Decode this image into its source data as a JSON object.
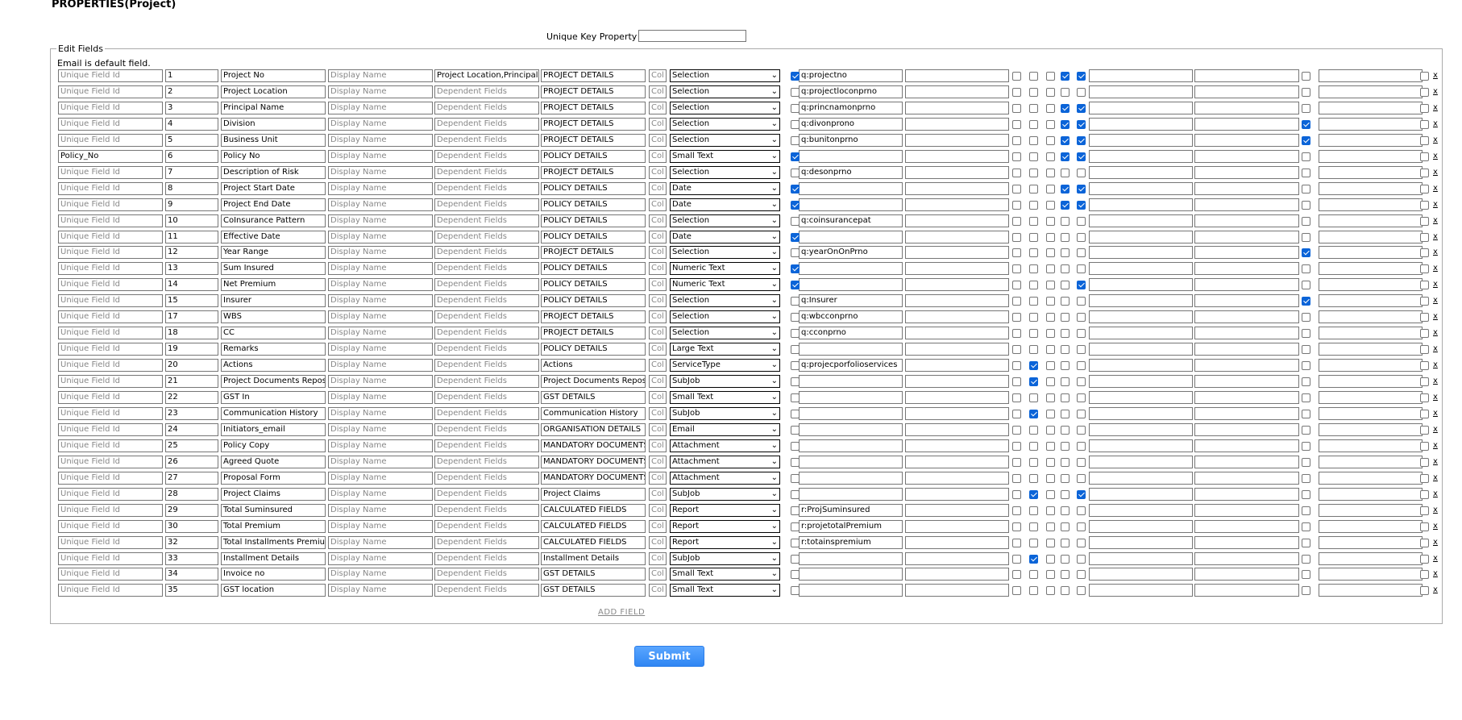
{
  "header": {
    "title": "PROPERTIES(Project)"
  },
  "unique_key": {
    "label": "Unique Key Property",
    "value": ""
  },
  "edit_fields": {
    "legend": "Edit Fields",
    "note": "Email is default field.",
    "placeholders": {
      "unique_field_id": "Unique Field Id",
      "display_name": "Display Name",
      "dependent_fields": "Dependent Fields",
      "col": "Col"
    },
    "remove_label": "x",
    "rows": [
      {
        "uid": "",
        "order": "1",
        "name": "Project No",
        "deps": "Project Location,Principal N",
        "section": "PROJECT DETAILS",
        "type": "Selection",
        "query": "q:projectno",
        "cb": [
          1,
          0,
          0,
          0,
          1,
          1,
          0,
          0
        ]
      },
      {
        "uid": "",
        "order": "2",
        "name": "Project Location",
        "deps": "",
        "section": "PROJECT DETAILS",
        "type": "Selection",
        "query": "q:projectloconprno",
        "cb": [
          0,
          0,
          0,
          0,
          0,
          0,
          0,
          0
        ]
      },
      {
        "uid": "",
        "order": "3",
        "name": "Principal Name",
        "deps": "",
        "section": "PROJECT DETAILS",
        "type": "Selection",
        "query": "q:princnamonprno",
        "cb": [
          0,
          0,
          0,
          0,
          1,
          1,
          0,
          0
        ]
      },
      {
        "uid": "",
        "order": "4",
        "name": "Division",
        "deps": "",
        "section": "PROJECT DETAILS",
        "type": "Selection",
        "query": "q:divonprono",
        "cb": [
          0,
          0,
          0,
          0,
          1,
          1,
          1,
          0
        ]
      },
      {
        "uid": "",
        "order": "5",
        "name": "Business Unit",
        "deps": "",
        "section": "PROJECT DETAILS",
        "type": "Selection",
        "query": "q:bunitonprno",
        "cb": [
          0,
          0,
          0,
          0,
          1,
          1,
          1,
          0
        ]
      },
      {
        "uid": "Policy_No",
        "order": "6",
        "name": "Policy No",
        "deps": "",
        "section": "POLICY DETAILS",
        "type": "Small Text",
        "query": "",
        "cb": [
          1,
          0,
          0,
          0,
          1,
          1,
          0,
          0
        ]
      },
      {
        "uid": "",
        "order": "7",
        "name": "Description of Risk",
        "deps": "",
        "section": "PROJECT DETAILS",
        "type": "Selection",
        "query": "q:desonprno",
        "cb": [
          0,
          0,
          0,
          0,
          0,
          0,
          0,
          0
        ]
      },
      {
        "uid": "",
        "order": "8",
        "name": "Project Start Date",
        "deps": "",
        "section": "POLICY DETAILS",
        "type": "Date",
        "query": "",
        "cb": [
          1,
          0,
          0,
          0,
          1,
          1,
          0,
          0
        ]
      },
      {
        "uid": "",
        "order": "9",
        "name": "Project End Date",
        "deps": "",
        "section": "POLICY DETAILS",
        "type": "Date",
        "query": "",
        "cb": [
          1,
          0,
          0,
          0,
          1,
          1,
          0,
          0
        ]
      },
      {
        "uid": "",
        "order": "10",
        "name": "CoInsurance Pattern",
        "deps": "",
        "section": "POLICY DETAILS",
        "type": "Selection",
        "query": "q:coinsurancepat",
        "cb": [
          0,
          0,
          0,
          0,
          0,
          0,
          0,
          0
        ]
      },
      {
        "uid": "",
        "order": "11",
        "name": "Effective Date",
        "deps": "",
        "section": "POLICY DETAILS",
        "type": "Date",
        "query": "",
        "cb": [
          1,
          0,
          0,
          0,
          0,
          0,
          0,
          0
        ]
      },
      {
        "uid": "",
        "order": "12",
        "name": "Year Range",
        "deps": "",
        "section": "PROJECT DETAILS",
        "type": "Selection",
        "query": "q:yearOnOnPrno",
        "cb": [
          0,
          0,
          0,
          0,
          0,
          0,
          1,
          0
        ]
      },
      {
        "uid": "",
        "order": "13",
        "name": "Sum Insured",
        "deps": "",
        "section": "POLICY DETAILS",
        "type": "Numeric Text",
        "query": "",
        "cb": [
          1,
          0,
          0,
          0,
          0,
          0,
          0,
          0
        ]
      },
      {
        "uid": "",
        "order": "14",
        "name": "Net Premium",
        "deps": "",
        "section": "POLICY DETAILS",
        "type": "Numeric Text",
        "query": "",
        "cb": [
          1,
          0,
          0,
          0,
          0,
          1,
          0,
          0
        ]
      },
      {
        "uid": "",
        "order": "15",
        "name": "Insurer",
        "deps": "",
        "section": "POLICY DETAILS",
        "type": "Selection",
        "query": "q:Insurer",
        "cb": [
          0,
          0,
          0,
          0,
          0,
          0,
          1,
          0
        ]
      },
      {
        "uid": "",
        "order": "17",
        "name": "WBS",
        "deps": "",
        "section": "PROJECT DETAILS",
        "type": "Selection",
        "query": "q:wbcconprno",
        "cb": [
          0,
          0,
          0,
          0,
          0,
          0,
          0,
          0
        ]
      },
      {
        "uid": "",
        "order": "18",
        "name": "CC",
        "deps": "",
        "section": "PROJECT DETAILS",
        "type": "Selection",
        "query": "q:cconprno",
        "cb": [
          0,
          0,
          0,
          0,
          0,
          0,
          0,
          0
        ]
      },
      {
        "uid": "",
        "order": "19",
        "name": "Remarks",
        "deps": "",
        "section": "POLICY DETAILS",
        "type": "Large Text",
        "query": "",
        "cb": [
          0,
          0,
          0,
          0,
          0,
          0,
          0,
          0
        ]
      },
      {
        "uid": "",
        "order": "20",
        "name": "Actions",
        "deps": "",
        "section": "Actions",
        "type": "ServiceType",
        "query": "q:projecporfolioservices",
        "cb": [
          0,
          0,
          1,
          0,
          0,
          0,
          0,
          0
        ]
      },
      {
        "uid": "",
        "order": "21",
        "name": "Project Documents Reposit",
        "deps": "",
        "section": "Project Documents Reposit",
        "type": "SubJob",
        "query": "",
        "cb": [
          0,
          0,
          1,
          0,
          0,
          0,
          0,
          0
        ]
      },
      {
        "uid": "",
        "order": "22",
        "name": "GST In",
        "deps": "",
        "section": "GST DETAILS",
        "type": "Small Text",
        "query": "",
        "cb": [
          0,
          0,
          0,
          0,
          0,
          0,
          0,
          0
        ]
      },
      {
        "uid": "",
        "order": "23",
        "name": "Communication History",
        "deps": "",
        "section": "Communication History",
        "type": "SubJob",
        "query": "",
        "cb": [
          0,
          0,
          1,
          0,
          0,
          0,
          0,
          0
        ]
      },
      {
        "uid": "",
        "order": "24",
        "name": "Initiators_email",
        "deps": "",
        "section": "ORGANISATION DETAILS",
        "type": "Email",
        "query": "",
        "cb": [
          0,
          0,
          0,
          0,
          0,
          0,
          0,
          0
        ]
      },
      {
        "uid": "",
        "order": "25",
        "name": "Policy Copy",
        "deps": "",
        "section": "MANDATORY DOCUMENTS",
        "type": "Attachment",
        "query": "",
        "cb": [
          0,
          0,
          0,
          0,
          0,
          0,
          0,
          0
        ]
      },
      {
        "uid": "",
        "order": "26",
        "name": "Agreed Quote",
        "deps": "",
        "section": "MANDATORY DOCUMENTS",
        "type": "Attachment",
        "query": "",
        "cb": [
          0,
          0,
          0,
          0,
          0,
          0,
          0,
          0
        ]
      },
      {
        "uid": "",
        "order": "27",
        "name": "Proposal Form",
        "deps": "",
        "section": "MANDATORY DOCUMENTS",
        "type": "Attachment",
        "query": "",
        "cb": [
          0,
          0,
          0,
          0,
          0,
          0,
          0,
          0
        ]
      },
      {
        "uid": "",
        "order": "28",
        "name": "Project Claims",
        "deps": "",
        "section": "Project Claims",
        "type": "SubJob",
        "query": "",
        "cb": [
          0,
          0,
          1,
          0,
          0,
          1,
          0,
          0
        ]
      },
      {
        "uid": "",
        "order": "29",
        "name": "Total Suminsured",
        "deps": "",
        "section": "CALCULATED FIELDS",
        "type": "Report",
        "query": "r:ProjSuminsured",
        "cb": [
          0,
          0,
          0,
          0,
          0,
          0,
          0,
          0
        ]
      },
      {
        "uid": "",
        "order": "30",
        "name": "Total Premium",
        "deps": "",
        "section": "CALCULATED FIELDS",
        "type": "Report",
        "query": "r:projetotalPremium",
        "cb": [
          0,
          0,
          0,
          0,
          0,
          0,
          0,
          0
        ]
      },
      {
        "uid": "",
        "order": "32",
        "name": "Total Installments Premium",
        "deps": "",
        "section": "CALCULATED FIELDS",
        "type": "Report",
        "query": "r:totainspremium",
        "cb": [
          0,
          0,
          0,
          0,
          0,
          0,
          0,
          0
        ]
      },
      {
        "uid": "",
        "order": "33",
        "name": "Installment Details",
        "deps": "",
        "section": "Installment Details",
        "type": "SubJob",
        "query": "",
        "cb": [
          0,
          0,
          1,
          0,
          0,
          0,
          0,
          0
        ]
      },
      {
        "uid": "",
        "order": "34",
        "name": "Invoice no",
        "deps": "",
        "section": "GST DETAILS",
        "type": "Small Text",
        "query": "",
        "cb": [
          0,
          0,
          0,
          0,
          0,
          0,
          0,
          0
        ]
      },
      {
        "uid": "",
        "order": "35",
        "name": "GST location",
        "deps": "",
        "section": "GST DETAILS",
        "type": "Small Text",
        "query": "",
        "cb": [
          0,
          0,
          0,
          0,
          0,
          0,
          0,
          0
        ]
      }
    ],
    "add_field_label": "ADD FIELD"
  },
  "submit_label": "Submit"
}
